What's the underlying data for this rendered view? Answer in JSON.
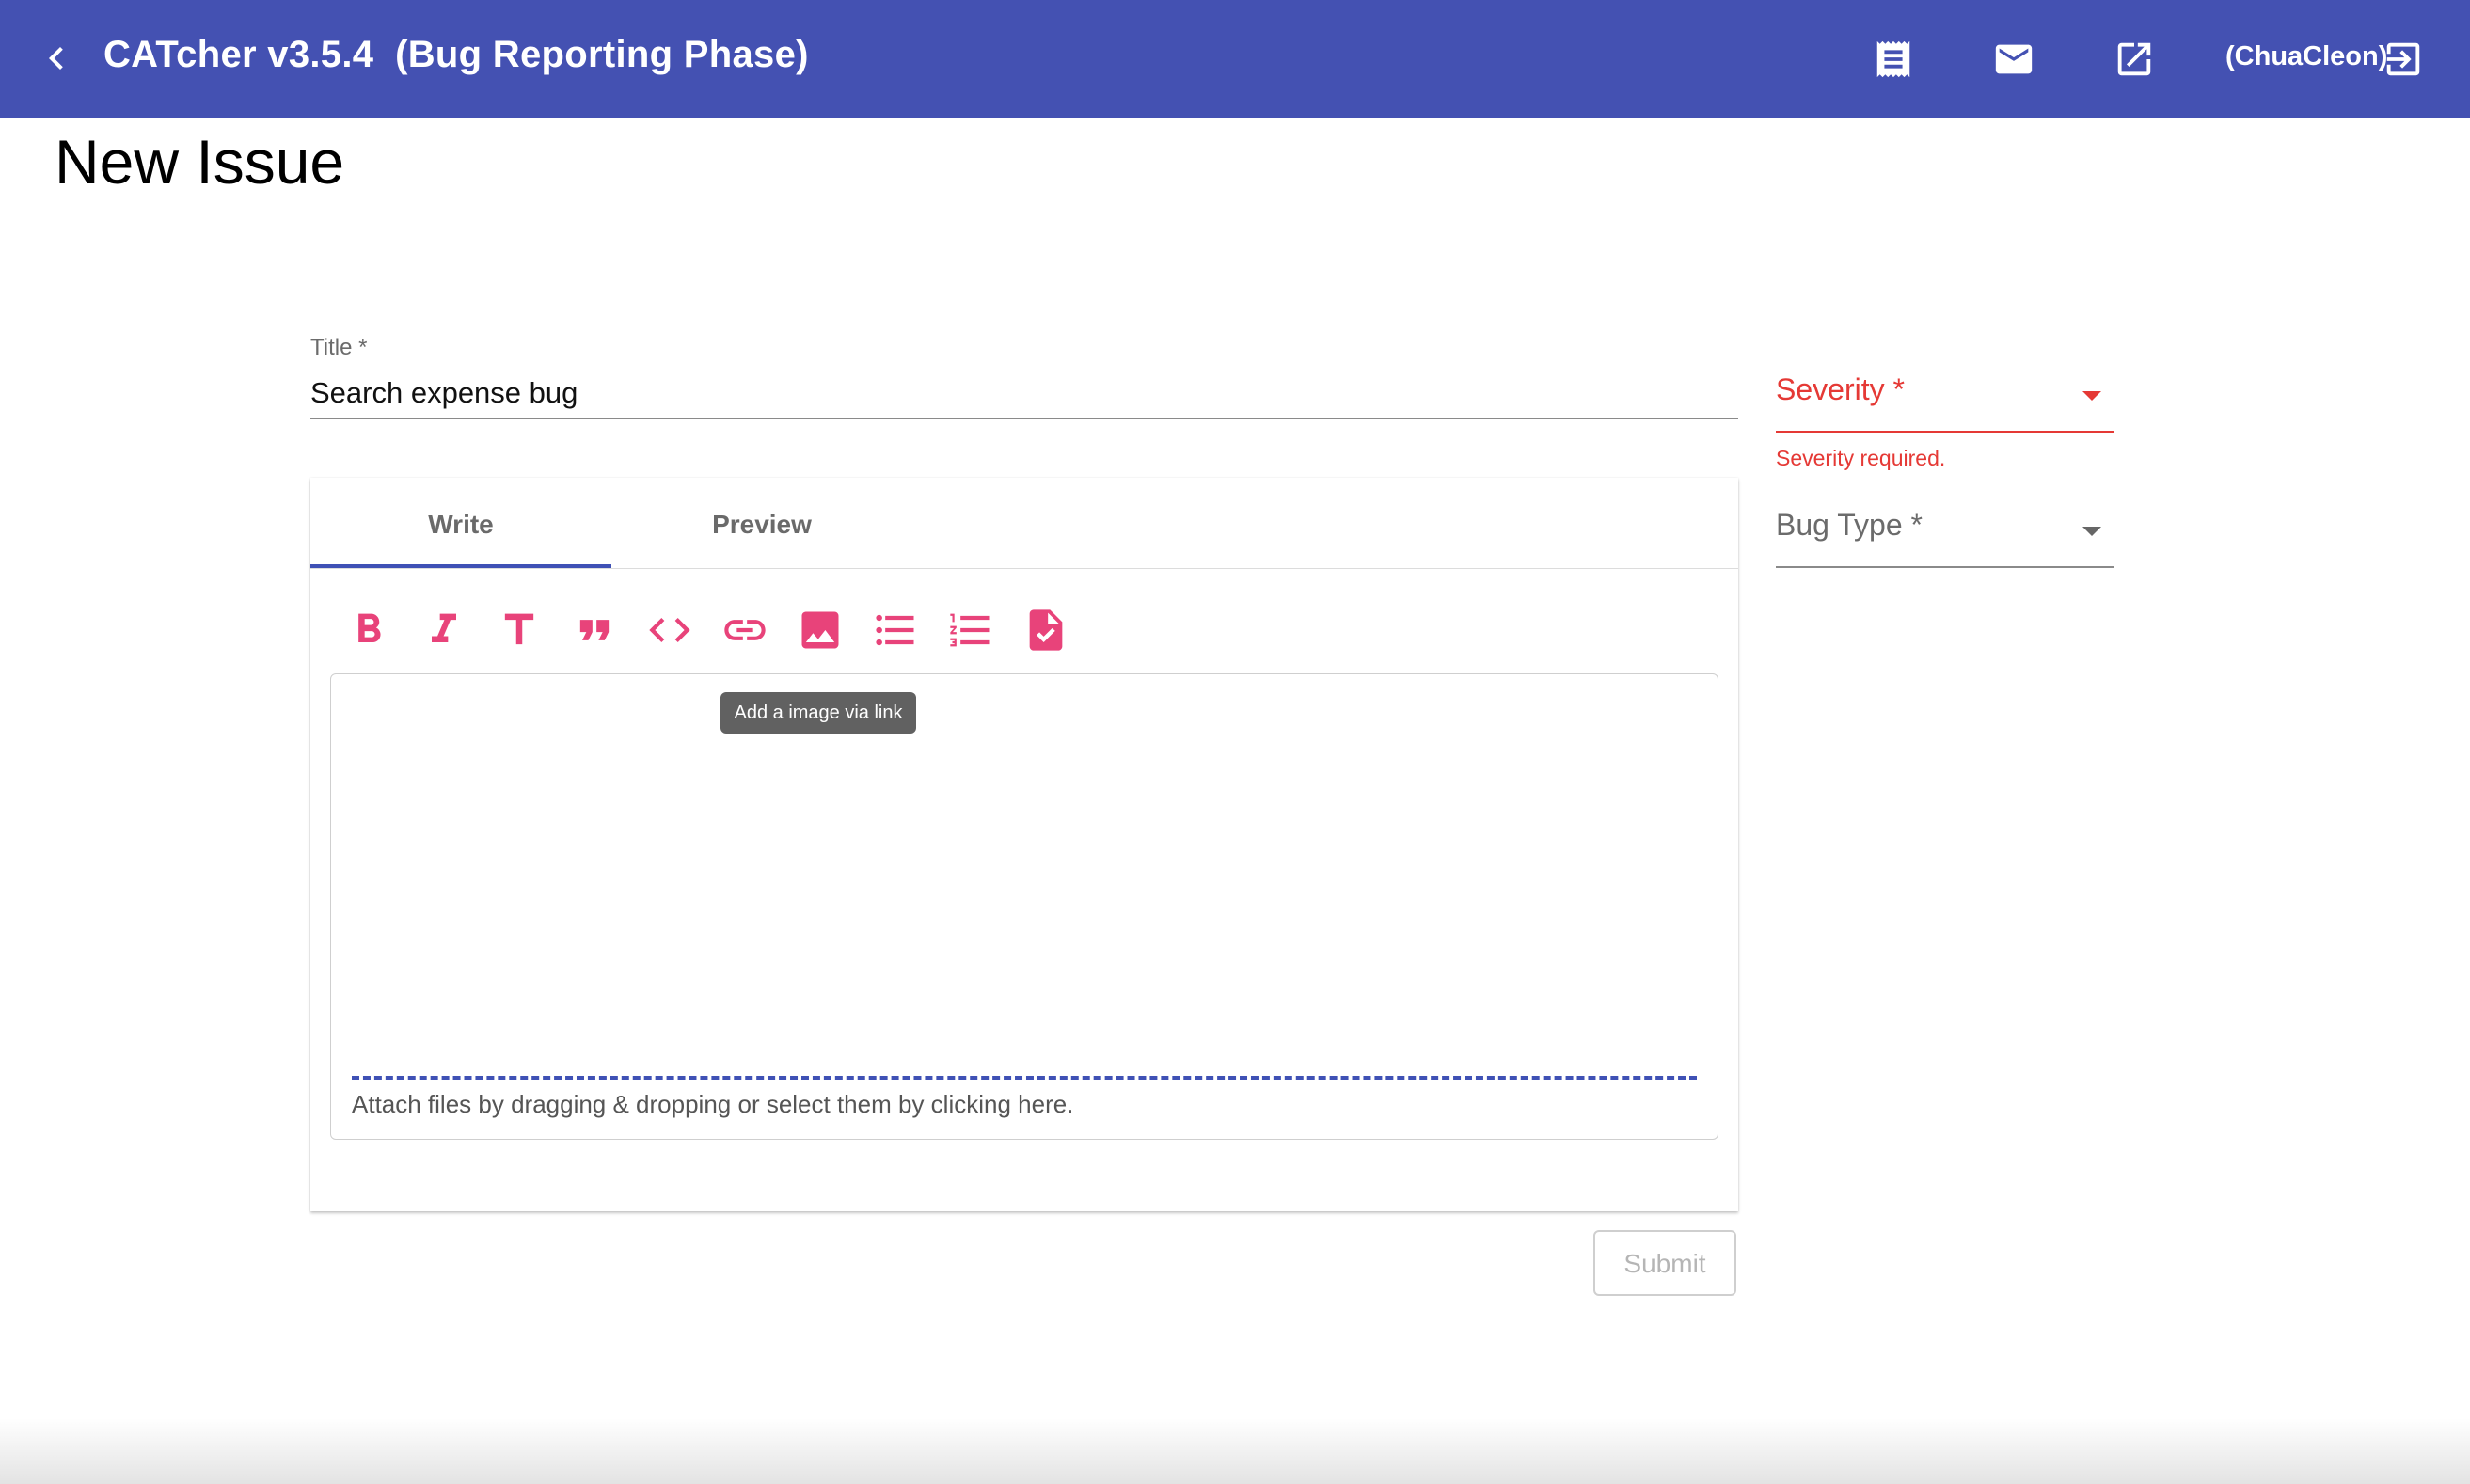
{
  "header": {
    "app_title": "CATcher v3.5.4  (Bug Reporting Phase)",
    "user": "(ChuaCleon)",
    "icons": [
      "back-arrow-icon",
      "receipt-icon",
      "mail-icon",
      "open-in-new-icon",
      "logout-icon"
    ]
  },
  "page": {
    "title": "New Issue"
  },
  "form": {
    "title_label": "Title *",
    "title_value": "Search expense bug",
    "severity": {
      "label": "Severity *",
      "error": "Severity required."
    },
    "bug_type": {
      "label": "Bug Type *"
    },
    "tabs": [
      {
        "label": "Write"
      },
      {
        "label": "Preview"
      }
    ],
    "toolbar": [
      "bold-icon",
      "italic-icon",
      "header-icon",
      "quote-icon",
      "code-icon",
      "link-icon",
      "image-icon",
      "bulleted-list-icon",
      "numbered-list-icon",
      "task-list-icon"
    ],
    "tooltip": "Add a image via link",
    "drop_text": "Attach files by dragging & dropping or select them by clicking here.",
    "submit_label": "Submit"
  },
  "colors": {
    "header_bg": "#4451b2",
    "accent": "#3f51b5",
    "toolbar_icon": "#e8437a",
    "error": "#e53935"
  }
}
